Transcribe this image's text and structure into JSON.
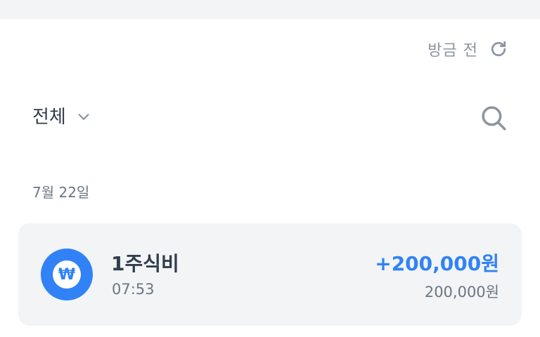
{
  "header": {
    "refresh_text": "방금 전",
    "refresh_icon": "refresh-icon"
  },
  "filter": {
    "label": "전체",
    "chevron_icon": "chevron-down-icon",
    "search_icon": "search-icon"
  },
  "date_group": {
    "label": "7월 22일"
  },
  "transaction": {
    "icon": "won-icon",
    "icon_glyph": "₩",
    "title": "1주식비",
    "time": "07:53",
    "amount": "+200,000원",
    "balance": "200,000원"
  },
  "colors": {
    "accent": "#3182f6",
    "background_strip": "#f2f4f6",
    "card_background": "#f2f4f6",
    "primary_text": "#333d4b",
    "secondary_text": "#6b7684",
    "muted_text": "#8b95a1"
  }
}
